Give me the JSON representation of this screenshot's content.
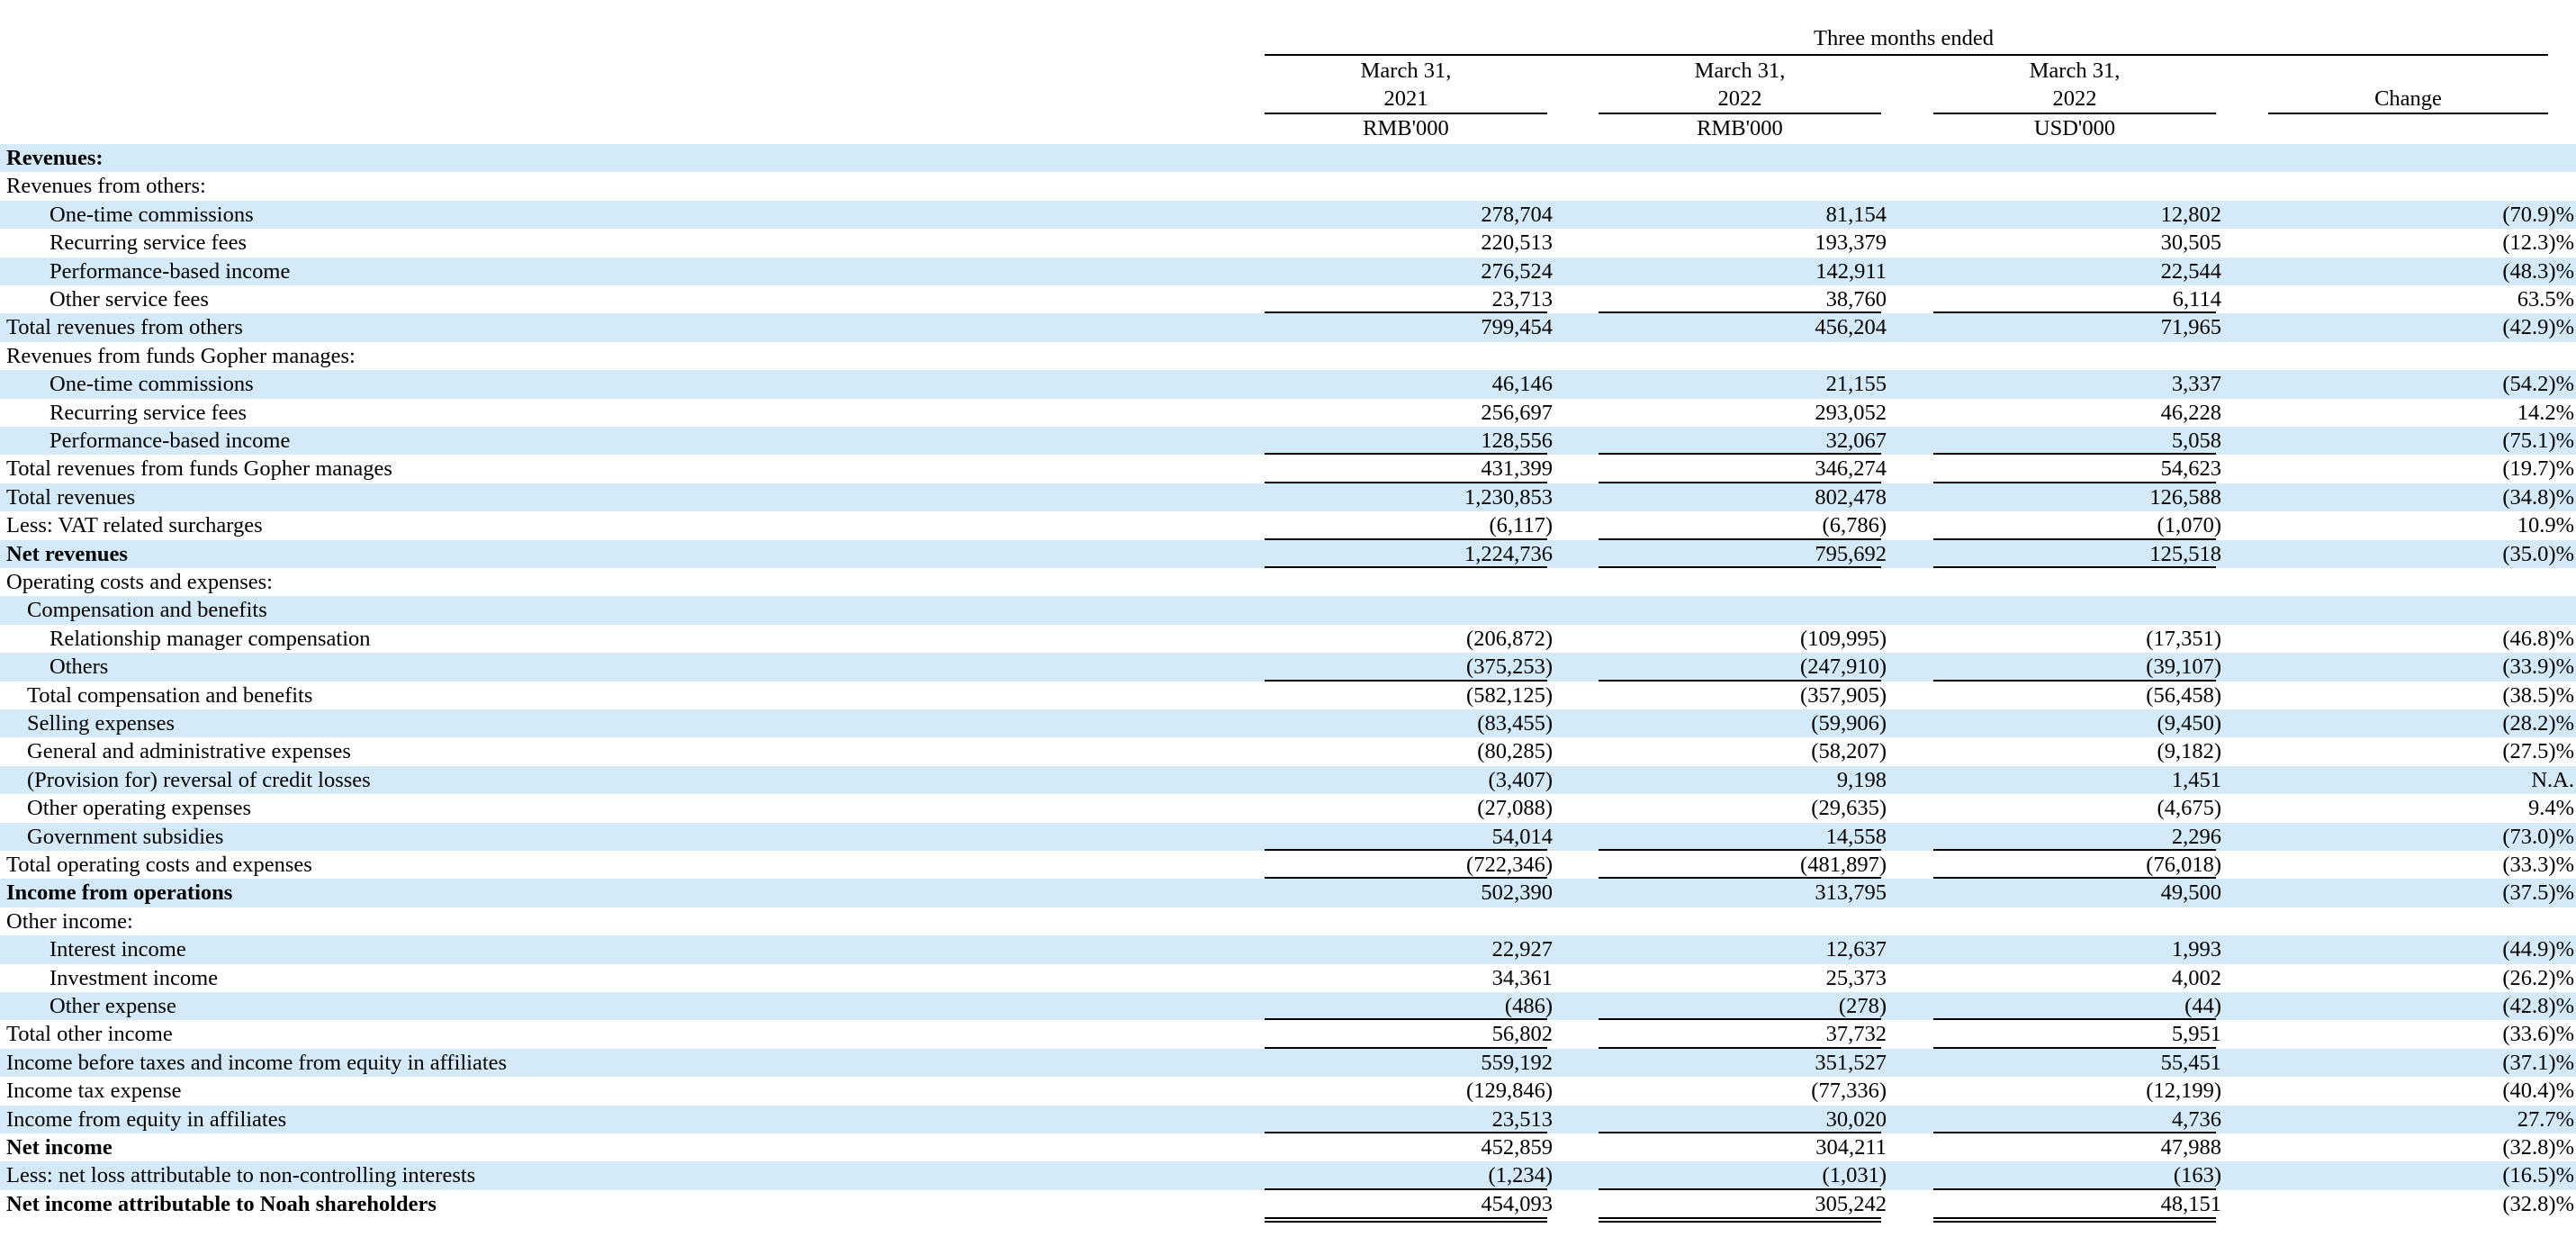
{
  "header": {
    "period": "Three months ended",
    "columns": [
      {
        "line1": "March 31,",
        "line2": "2021",
        "unit": "RMB'000"
      },
      {
        "line1": "March 31,",
        "line2": "2022",
        "unit": "RMB'000"
      },
      {
        "line1": "March 31,",
        "line2": "2022",
        "unit": "USD'000"
      },
      {
        "line1": "",
        "line2": "Change",
        "unit": ""
      }
    ]
  },
  "rows": [
    {
      "label": "Revenues:",
      "bold": true,
      "indent": 0,
      "values": [
        "",
        "",
        "",
        ""
      ]
    },
    {
      "label": "Revenues from others:",
      "indent": 0,
      "values": [
        "",
        "",
        "",
        ""
      ]
    },
    {
      "label": "One-time commissions",
      "indent": 2,
      "values": [
        "278,704",
        "81,154",
        "12,802",
        "(70.9)%"
      ]
    },
    {
      "label": "Recurring service fees",
      "indent": 2,
      "values": [
        "220,513",
        "193,379",
        "30,505",
        "(12.3)%"
      ]
    },
    {
      "label": "Performance-based income",
      "indent": 2,
      "values": [
        "276,524",
        "142,911",
        "22,544",
        "(48.3)%"
      ]
    },
    {
      "label": "Other service fees",
      "indent": 2,
      "values": [
        "23,713",
        "38,760",
        "6,114",
        "63.5%"
      ],
      "rule": "single"
    },
    {
      "label": "Total revenues from others",
      "indent": 0,
      "values": [
        "799,454",
        "456,204",
        "71,965",
        "(42.9)%"
      ]
    },
    {
      "label": "Revenues from funds Gopher manages:",
      "indent": 0,
      "values": [
        "",
        "",
        "",
        ""
      ]
    },
    {
      "label": "One-time commissions",
      "indent": 2,
      "values": [
        "46,146",
        "21,155",
        "3,337",
        "(54.2)%"
      ]
    },
    {
      "label": "Recurring service fees",
      "indent": 2,
      "values": [
        "256,697",
        "293,052",
        "46,228",
        "14.2%"
      ]
    },
    {
      "label": "Performance-based income",
      "indent": 2,
      "values": [
        "128,556",
        "32,067",
        "5,058",
        "(75.1)%"
      ],
      "rule": "single"
    },
    {
      "label": "Total revenues from funds Gopher manages",
      "indent": 0,
      "values": [
        "431,399",
        "346,274",
        "54,623",
        "(19.7)%"
      ],
      "rule": "single"
    },
    {
      "label": "Total revenues",
      "indent": 0,
      "values": [
        "1,230,853",
        "802,478",
        "126,588",
        "(34.8)%"
      ]
    },
    {
      "label": "Less: VAT related surcharges",
      "indent": 0,
      "values": [
        "(6,117)",
        "(6,786)",
        "(1,070)",
        "10.9%"
      ],
      "rule": "single"
    },
    {
      "label": "Net revenues",
      "bold": true,
      "indent": 0,
      "values": [
        "1,224,736",
        "795,692",
        "125,518",
        "(35.0)%"
      ],
      "rule": "single"
    },
    {
      "label": "Operating costs and expenses:",
      "indent": 0,
      "values": [
        "",
        "",
        "",
        ""
      ]
    },
    {
      "label": "Compensation and benefits",
      "indent": 1,
      "values": [
        "",
        "",
        "",
        ""
      ]
    },
    {
      "label": "Relationship manager compensation",
      "indent": 2,
      "values": [
        "(206,872)",
        "(109,995)",
        "(17,351)",
        "(46.8)%"
      ]
    },
    {
      "label": "Others",
      "indent": 2,
      "values": [
        "(375,253)",
        "(247,910)",
        "(39,107)",
        "(33.9)%"
      ],
      "rule": "single"
    },
    {
      "label": "Total compensation and benefits",
      "indent": 1,
      "values": [
        "(582,125)",
        "(357,905)",
        "(56,458)",
        "(38.5)%"
      ]
    },
    {
      "label": "Selling expenses",
      "indent": 1,
      "values": [
        "(83,455)",
        "(59,906)",
        "(9,450)",
        "(28.2)%"
      ]
    },
    {
      "label": "General and administrative expenses",
      "indent": 1,
      "values": [
        "(80,285)",
        "(58,207)",
        "(9,182)",
        "(27.5)%"
      ]
    },
    {
      "label": "(Provision for) reversal of credit losses",
      "indent": 1,
      "values": [
        "(3,407)",
        "9,198",
        "1,451",
        "N.A."
      ]
    },
    {
      "label": "Other operating expenses",
      "indent": 1,
      "values": [
        "(27,088)",
        "(29,635)",
        "(4,675)",
        "9.4%"
      ]
    },
    {
      "label": "Government subsidies",
      "indent": 1,
      "values": [
        "54,014",
        "14,558",
        "2,296",
        "(73.0)%"
      ],
      "rule": "single"
    },
    {
      "label": "Total operating costs and expenses",
      "indent": 0,
      "values": [
        "(722,346)",
        "(481,897)",
        "(76,018)",
        "(33.3)%"
      ],
      "rule": "single"
    },
    {
      "label": "Income from operations",
      "bold": true,
      "indent": 0,
      "values": [
        "502,390",
        "313,795",
        "49,500",
        "(37.5)%"
      ]
    },
    {
      "label": "Other income:",
      "indent": 0,
      "values": [
        "",
        "",
        "",
        ""
      ]
    },
    {
      "label": "Interest income",
      "indent": 2,
      "values": [
        "22,927",
        "12,637",
        "1,993",
        "(44.9)%"
      ]
    },
    {
      "label": "Investment income",
      "indent": 2,
      "values": [
        "34,361",
        "25,373",
        "4,002",
        "(26.2)%"
      ]
    },
    {
      "label": "Other expense",
      "indent": 2,
      "values": [
        "(486)",
        "(278)",
        "(44)",
        "(42.8)%"
      ],
      "rule": "single"
    },
    {
      "label": "Total other income",
      "indent": 0,
      "values": [
        "56,802",
        "37,732",
        "5,951",
        "(33.6)%"
      ],
      "rule": "single"
    },
    {
      "label": "Income before taxes and income from equity in affiliates",
      "indent": 0,
      "values": [
        "559,192",
        "351,527",
        "55,451",
        "(37.1)%"
      ]
    },
    {
      "label": "Income tax expense",
      "indent": 0,
      "values": [
        "(129,846)",
        "(77,336)",
        "(12,199)",
        "(40.4)%"
      ]
    },
    {
      "label": "Income from equity in affiliates",
      "indent": 0,
      "values": [
        "23,513",
        "30,020",
        "4,736",
        "27.7%"
      ],
      "rule": "single"
    },
    {
      "label": "Net income",
      "bold": true,
      "indent": 0,
      "values": [
        "452,859",
        "304,211",
        "47,988",
        "(32.8)%"
      ]
    },
    {
      "label": "Less: net loss attributable to non-controlling interests",
      "indent": 0,
      "values": [
        "(1,234)",
        "(1,031)",
        "(163)",
        "(16.5)%"
      ],
      "rule": "single"
    },
    {
      "label": "Net income attributable to Noah shareholders",
      "bold": true,
      "indent": 0,
      "values": [
        "454,093",
        "305,242",
        "48,151",
        "(32.8)%"
      ],
      "rule": "double"
    }
  ]
}
